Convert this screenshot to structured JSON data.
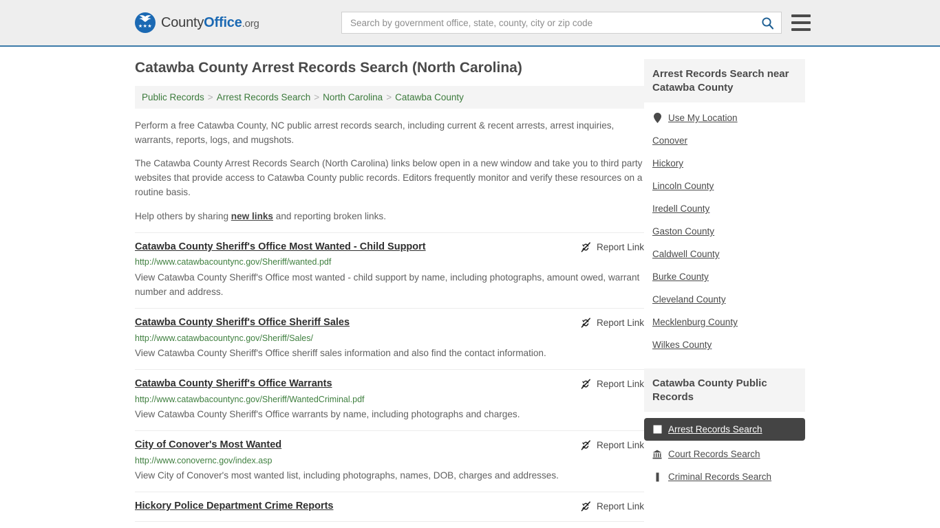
{
  "header": {
    "brand": {
      "part1": "County",
      "part2": "Office",
      "part3": ".org",
      "logo_icon": "eagle-seal-icon",
      "stars": "★★★"
    },
    "search": {
      "placeholder": "Search by government office, state, county, city or zip code",
      "value": "",
      "icon": "search-icon"
    },
    "menu_icon": "hamburger-menu-icon",
    "accent_color": "#3b7aa8"
  },
  "main": {
    "title": "Catawba County Arrest Records Search (North Carolina)",
    "breadcrumb": [
      "Public Records",
      "Arrest Records Search",
      "North Carolina",
      "Catawba County"
    ],
    "breadcrumb_separator": ">",
    "intro": {
      "p1": "Perform a free Catawba County, NC public arrest records search, including current & recent arrests, arrest inquiries, warrants, reports, logs, and mugshots.",
      "p2": "The Catawba County Arrest Records Search (North Carolina) links below open in a new window and take you to third party websites that provide access to Catawba County public records. Editors frequently monitor and verify these resources on a routine basis.",
      "p3_before": "Help others by sharing ",
      "p3_link": "new links",
      "p3_after": " and reporting broken links."
    },
    "report_link_label": "Report Link",
    "report_link_icon": "broken-link-icon",
    "results": [
      {
        "title": "Catawba County Sheriff's Office Most Wanted - Child Support",
        "url": "http://www.catawbacountync.gov/Sheriff/wanted.pdf",
        "description": "View Catawba County Sheriff's Office most wanted - child support by name, including photographs, amount owed, warrant number and address."
      },
      {
        "title": "Catawba County Sheriff's Office Sheriff Sales",
        "url": "http://www.catawbacountync.gov/Sheriff/Sales/",
        "description": "View Catawba County Sheriff's Office sheriff sales information and also find the contact information."
      },
      {
        "title": "Catawba County Sheriff's Office Warrants",
        "url": "http://www.catawbacountync.gov/Sheriff/WantedCriminal.pdf",
        "description": "View Catawba County Sheriff's Office warrants by name, including photographs and charges."
      },
      {
        "title": "City of Conover's Most Wanted",
        "url": "http://www.conovernc.gov/index.asp",
        "description": "View City of Conover's most wanted list, including photographs, names, DOB, charges and addresses."
      },
      {
        "title": "Hickory Police Department Crime Reports",
        "url": "",
        "description": ""
      }
    ]
  },
  "sidebar": {
    "near_panel": {
      "heading": "Arrest Records Search near Catawba County",
      "items": [
        {
          "label": "Use My Location",
          "icon": "map-pin-icon"
        },
        {
          "label": "Conover",
          "icon": ""
        },
        {
          "label": "Hickory",
          "icon": ""
        },
        {
          "label": "Lincoln County",
          "icon": ""
        },
        {
          "label": "Iredell County",
          "icon": ""
        },
        {
          "label": "Gaston County",
          "icon": ""
        },
        {
          "label": "Caldwell County",
          "icon": ""
        },
        {
          "label": "Burke County",
          "icon": ""
        },
        {
          "label": "Cleveland County",
          "icon": ""
        },
        {
          "label": "Mecklenburg County",
          "icon": ""
        },
        {
          "label": "Wilkes County",
          "icon": ""
        }
      ]
    },
    "records_panel": {
      "heading": "Catawba County Public Records",
      "items": [
        {
          "label": "Arrest Records Search",
          "icon": "document-icon",
          "active": true
        },
        {
          "label": "Court Records Search",
          "icon": "courthouse-icon",
          "active": false
        },
        {
          "label": "Criminal Records Search",
          "icon": "file-icon",
          "active": false
        }
      ]
    }
  }
}
